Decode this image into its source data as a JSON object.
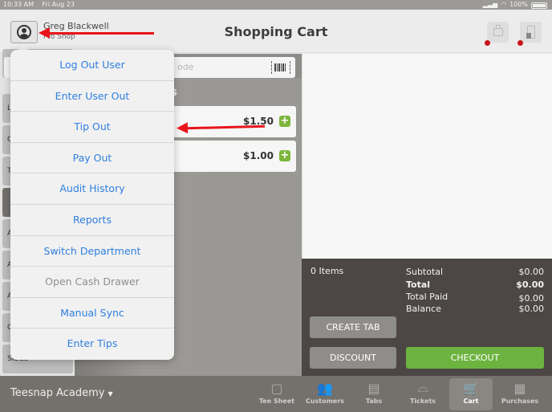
{
  "status_bar": {
    "time": "10:33 AM",
    "date": "Fri Aug 23",
    "battery": "100%"
  },
  "header": {
    "user_name": "Greg Blackwell",
    "department": "Pro Shop",
    "title": "Shopping Cart"
  },
  "search": {
    "placeholder_visible": "ode"
  },
  "categories": [
    {
      "label": "L"
    },
    {
      "label": "C"
    },
    {
      "label": "T"
    },
    {
      "label": "",
      "active": true
    },
    {
      "label": "A B"
    },
    {
      "label": "A"
    },
    {
      "label": "A"
    },
    {
      "label": "C"
    },
    {
      "label": "SIDES"
    }
  ],
  "products": {
    "section_title": "es",
    "items": [
      {
        "price": "$1.50"
      },
      {
        "price": "$1.00"
      }
    ]
  },
  "menu": {
    "items": [
      {
        "label": "Log Out User",
        "enabled": true
      },
      {
        "label": "Enter User Out",
        "enabled": true
      },
      {
        "label": "Tip Out",
        "enabled": true
      },
      {
        "label": "Pay Out",
        "enabled": true
      },
      {
        "label": "Audit History",
        "enabled": true
      },
      {
        "label": "Reports",
        "enabled": true
      },
      {
        "label": "Switch Department",
        "enabled": true
      },
      {
        "label": "Open Cash Drawer",
        "enabled": false
      },
      {
        "label": "Manual Sync",
        "enabled": true
      },
      {
        "label": "Enter Tips",
        "enabled": true
      }
    ]
  },
  "summary": {
    "items_count": "0 Items",
    "rows": [
      {
        "label": "Subtotal",
        "value": "$0.00"
      },
      {
        "label": "Total",
        "value": "$0.00"
      },
      {
        "label": "Total Paid",
        "value": "$0.00"
      },
      {
        "label": "Balance",
        "value": "$0.00"
      }
    ],
    "create_tab_label": "CREATE TAB",
    "discount_label": "DISCOUNT",
    "checkout_label": "CHECKOUT"
  },
  "bottom_bar": {
    "org_name": "Teesnap Academy",
    "nav": [
      {
        "label": "Tee Sheet",
        "icon": "calendar-icon",
        "glyph": "▢"
      },
      {
        "label": "Customers",
        "icon": "customers-icon",
        "glyph": "👥"
      },
      {
        "label": "Tabs",
        "icon": "tabs-icon",
        "glyph": "▤"
      },
      {
        "label": "Tickets",
        "icon": "cloche-icon",
        "glyph": "⌓"
      },
      {
        "label": "Cart",
        "icon": "cart-icon",
        "glyph": "🛒",
        "active": true
      },
      {
        "label": "Purchases",
        "icon": "register-icon",
        "glyph": "▦"
      }
    ]
  },
  "colors": {
    "accent_blue": "#2f7fe0",
    "checkout_green": "#6db33f",
    "plus_green": "#7cb63b",
    "alert_red": "#c9141b",
    "annotation_red": "#e8151b"
  }
}
